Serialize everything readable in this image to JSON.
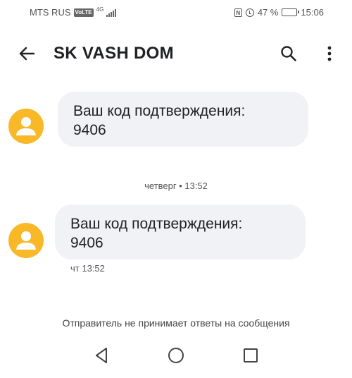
{
  "status_bar": {
    "carrier": "MTS RUS",
    "volte": "VoLTE",
    "network": "4G",
    "battery_percent": "47 %",
    "battery_level": 0.47,
    "time": "15:06",
    "nfc": "N"
  },
  "app_bar": {
    "title": "SK VASH DOM"
  },
  "messages": [
    {
      "line1": "Ваш код подтверждения:",
      "line2": "9406"
    },
    {
      "line1": "Ваш код подтверждения:",
      "line2": "9406"
    }
  ],
  "date_divider": "четверг • 13:52",
  "message_time": "чт 13:52",
  "footer_note": "Отправитель не принимает ответы на сообщения",
  "colors": {
    "avatar": "#f9b827",
    "bubble": "#f1f2f6"
  }
}
